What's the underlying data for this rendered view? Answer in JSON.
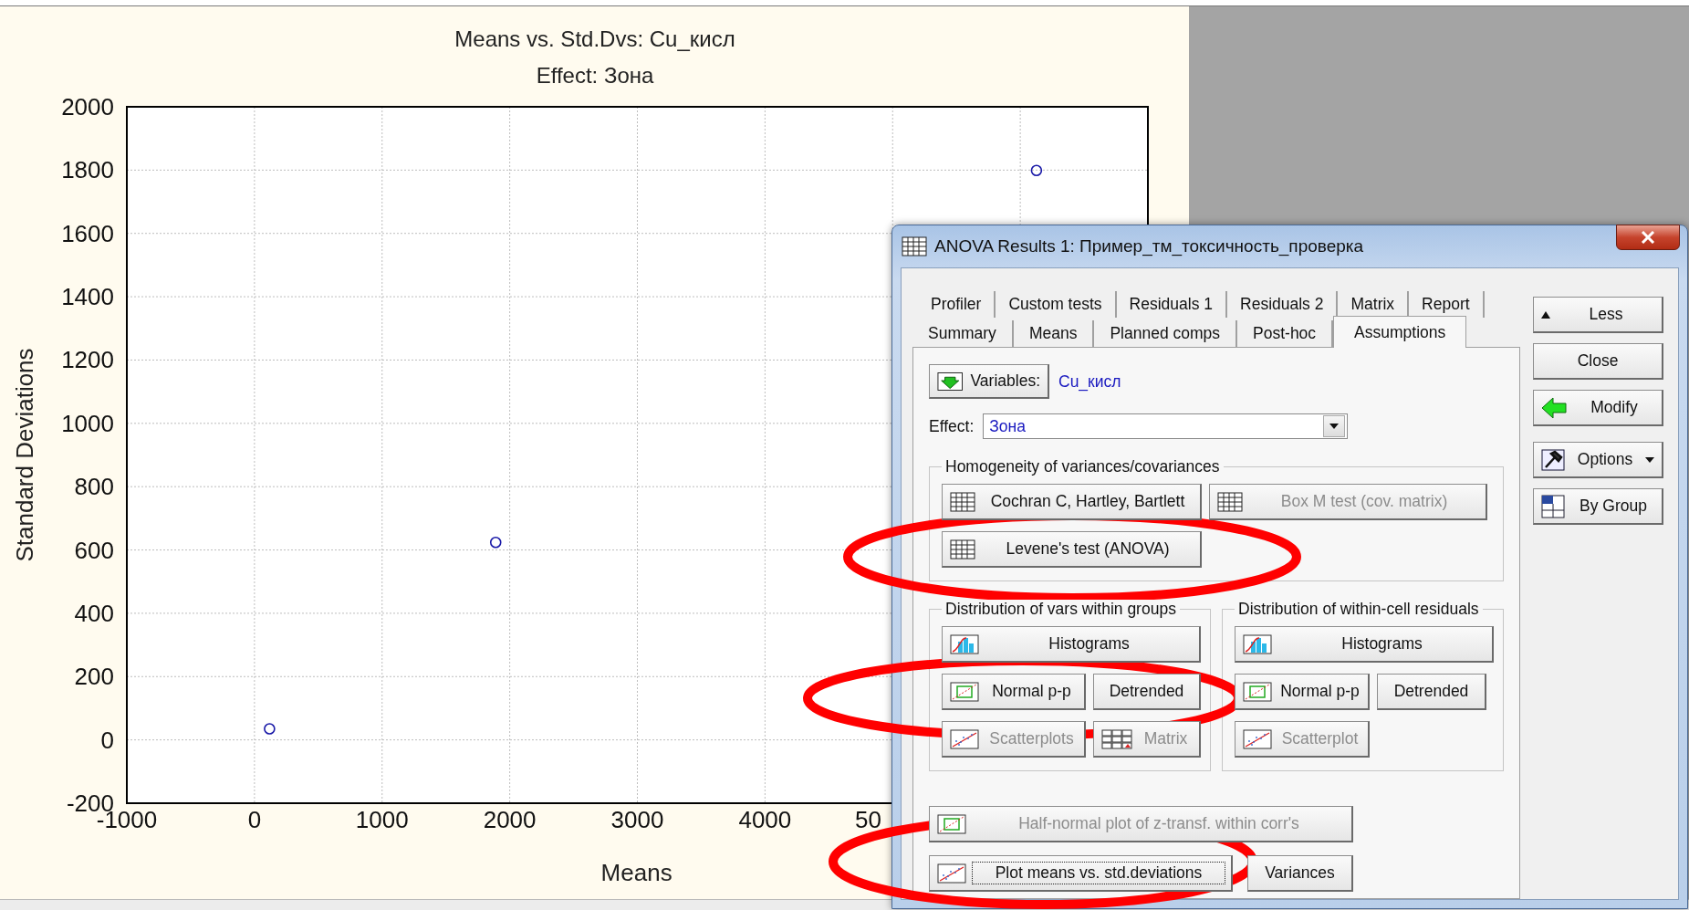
{
  "chart": {
    "effect_label": "Effect: Зона",
    "cut_tick_label": "50",
    "chart_data": {
      "type": "scatter",
      "title": "Means vs. Std.Dvs: Cu_кисл",
      "xlabel": "Means",
      "ylabel": "Standard Deviations",
      "x": [
        118,
        1890,
        6127
      ],
      "series": [
        {
          "color": "#1a1aa8",
          "values": [
            35,
            624,
            1799
          ]
        }
      ],
      "xlim": [
        -1000,
        7000
      ],
      "ylim": [
        -200,
        2000
      ],
      "grid": true,
      "xticks": [
        -1000,
        0,
        1000,
        2000,
        3000,
        4000
      ],
      "yticks": [
        -200,
        0,
        200,
        400,
        600,
        800,
        1000,
        1200,
        1400,
        1600,
        1800,
        2000
      ]
    }
  },
  "dialog": {
    "title": "ANOVA Results 1: Пример_тм_токсичность_проверка",
    "tab_rows": [
      [
        {
          "label": "Profiler",
          "selected": false
        },
        {
          "label": "Custom tests",
          "selected": false
        },
        {
          "label": "Residuals 1",
          "selected": false
        },
        {
          "label": "Residuals 2",
          "selected": false
        },
        {
          "label": "Matrix",
          "selected": false
        },
        {
          "label": "Report",
          "selected": false
        }
      ],
      [
        {
          "label": "Summary",
          "selected": false
        },
        {
          "label": "Means",
          "selected": false
        },
        {
          "label": "Planned comps",
          "selected": false
        },
        {
          "label": "Post-hoc",
          "selected": false
        },
        {
          "label": "Assumptions",
          "selected": true
        }
      ]
    ],
    "variables": {
      "button": "Variables:",
      "value": "Cu_кисл"
    },
    "effect": {
      "label": "Effect:",
      "value": "Зона"
    },
    "groups": [
      {
        "title": "Homogeneity of variances/covariances",
        "rows": [
          [
            {
              "label": "Cochran C, Hartley, Bartlett",
              "kind": "table",
              "disabled": false,
              "focused": false
            },
            {
              "label": "Box M test (cov. matrix)",
              "kind": "table",
              "disabled": true,
              "focused": false
            }
          ],
          [
            {
              "label": "Levene's test (ANOVA)",
              "kind": "table",
              "disabled": false,
              "focused": false
            }
          ]
        ]
      },
      {
        "title": "Distribution of vars within groups",
        "rows": [
          [
            {
              "label": "Histograms",
              "kind": "histogram",
              "disabled": false,
              "focused": false
            }
          ],
          [
            {
              "label": "Normal p-p",
              "kind": "probability",
              "disabled": false,
              "focused": false
            },
            {
              "label": "Detrended",
              "kind": "none",
              "disabled": false,
              "focused": false
            }
          ],
          [
            {
              "label": "Scatterplots",
              "kind": "scatter",
              "disabled": true,
              "focused": false
            },
            {
              "label": "Matrix",
              "kind": "matrix",
              "disabled": true,
              "focused": false
            }
          ]
        ]
      },
      {
        "title": "Distribution of within-cell residuals",
        "rows": [
          [
            {
              "label": "Histograms",
              "kind": "histogram",
              "disabled": false,
              "focused": false
            }
          ],
          [
            {
              "label": "Normal p-p",
              "kind": "probability",
              "disabled": false,
              "focused": false
            },
            {
              "label": "Detrended",
              "kind": "none",
              "disabled": false,
              "focused": false
            }
          ],
          [
            {
              "label": "Scatterplot",
              "kind": "scatter",
              "disabled": true,
              "focused": false
            }
          ]
        ]
      }
    ],
    "bottom_rows": [
      [
        {
          "label": "Half-normal plot of z-transf. within corr's",
          "kind": "probability",
          "disabled": true,
          "focused": false
        }
      ],
      [
        {
          "label": "Plot means vs. std.deviations",
          "kind": "scatter",
          "disabled": false,
          "focused": true
        },
        {
          "label": "Variances",
          "kind": "none",
          "disabled": false,
          "focused": false
        }
      ]
    ],
    "side_buttons": [
      {
        "label": "Less",
        "kind": "less"
      },
      {
        "label": "Close",
        "kind": "none"
      },
      {
        "label": "Modify",
        "kind": "modify"
      },
      {
        "label": "Options",
        "kind": "options"
      },
      {
        "label": "By Group",
        "kind": "bygroup"
      }
    ]
  }
}
